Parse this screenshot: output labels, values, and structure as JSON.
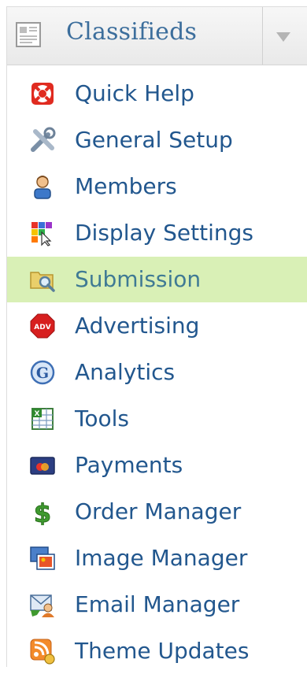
{
  "header": {
    "title": "Classifieds",
    "icon": "document-icon",
    "toggle_icon": "chevron-down-icon"
  },
  "active_item": "Submission",
  "colors": {
    "link": "#22578e",
    "active_bg": "#d9f0b6",
    "title": "#3c6e9c"
  },
  "menu": {
    "items": [
      {
        "label": "Quick Help",
        "icon": "lifebuoy-icon"
      },
      {
        "label": "General Setup",
        "icon": "tools-icon"
      },
      {
        "label": "Members",
        "icon": "user-icon"
      },
      {
        "label": "Display Settings",
        "icon": "palette-icon"
      },
      {
        "label": "Submission",
        "icon": "folder-search-icon"
      },
      {
        "label": "Advertising",
        "icon": "adv-badge-icon"
      },
      {
        "label": "Analytics",
        "icon": "google-icon"
      },
      {
        "label": "Tools",
        "icon": "spreadsheet-icon"
      },
      {
        "label": "Payments",
        "icon": "credit-card-icon"
      },
      {
        "label": "Order Manager",
        "icon": "dollar-icon"
      },
      {
        "label": "Image Manager",
        "icon": "images-icon"
      },
      {
        "label": "Email Manager",
        "icon": "email-user-icon"
      },
      {
        "label": "Theme Updates",
        "icon": "rss-icon"
      }
    ]
  }
}
